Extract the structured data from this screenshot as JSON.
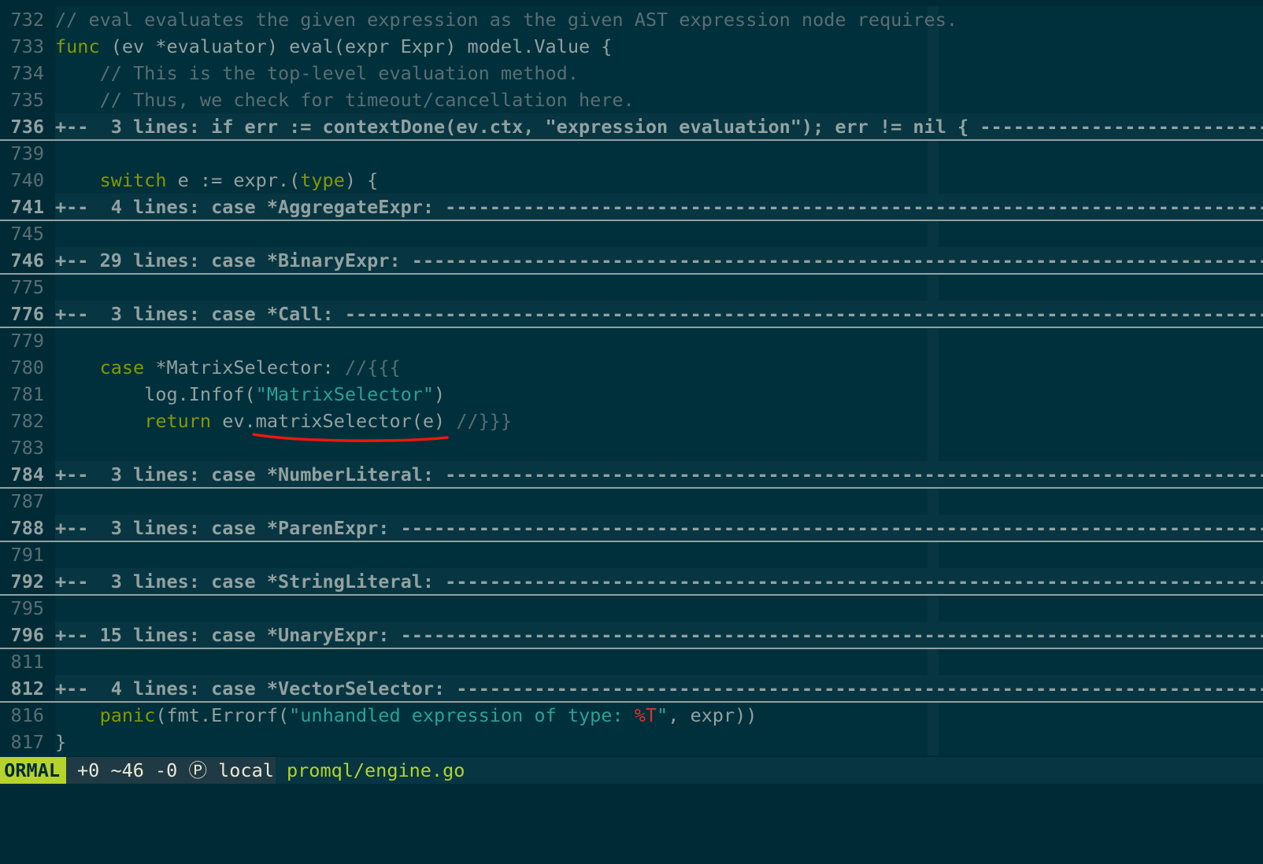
{
  "editor": {
    "lines": [
      {
        "num": "732",
        "fold": false,
        "tokens": [
          {
            "t": "// eval evaluates the given expression as the given AST expression node requires.",
            "c": "comment"
          }
        ]
      },
      {
        "num": "733",
        "fold": false,
        "tokens": [
          {
            "t": "func",
            "c": "kw"
          },
          {
            "t": " (ev *evaluator) eval(expr Expr) model.Value {",
            "c": "plain"
          }
        ]
      },
      {
        "num": "734",
        "fold": false,
        "tokens": [
          {
            "t": "    ",
            "c": "plain"
          },
          {
            "t": "// This is the top-level evaluation method.",
            "c": "comment"
          }
        ]
      },
      {
        "num": "735",
        "fold": false,
        "tokens": [
          {
            "t": "    ",
            "c": "plain"
          },
          {
            "t": "// Thus, we check for timeout/cancellation here.",
            "c": "comment"
          }
        ]
      },
      {
        "num": "736",
        "fold": true,
        "tokens": [
          {
            "t": "+--  3 lines: if err := contextDone(ev.ctx, \"expression evaluation\"); err != nil { ------------------------------------------------",
            "c": "fold"
          }
        ]
      },
      {
        "num": "739",
        "fold": false,
        "tokens": []
      },
      {
        "num": "740",
        "fold": false,
        "tokens": [
          {
            "t": "    ",
            "c": "plain"
          },
          {
            "t": "switch",
            "c": "kw"
          },
          {
            "t": " e := expr.(",
            "c": "plain"
          },
          {
            "t": "type",
            "c": "kw"
          },
          {
            "t": ") {",
            "c": "plain"
          }
        ]
      },
      {
        "num": "741",
        "fold": true,
        "tokens": [
          {
            "t": "+--  4 lines: case *AggregateExpr: ------------------------------------------------------------------------------------------------",
            "c": "fold"
          }
        ]
      },
      {
        "num": "745",
        "fold": false,
        "tokens": []
      },
      {
        "num": "746",
        "fold": true,
        "tokens": [
          {
            "t": "+-- 29 lines: case *BinaryExpr: ---------------------------------------------------------------------------------------------------",
            "c": "fold"
          }
        ]
      },
      {
        "num": "775",
        "fold": false,
        "tokens": []
      },
      {
        "num": "776",
        "fold": true,
        "tokens": [
          {
            "t": "+--  3 lines: case *Call: -------------------------------------------------------------------------------------------------------------",
            "c": "fold"
          }
        ]
      },
      {
        "num": "779",
        "fold": false,
        "tokens": []
      },
      {
        "num": "780",
        "fold": false,
        "tokens": [
          {
            "t": "    ",
            "c": "plain"
          },
          {
            "t": "case",
            "c": "kw"
          },
          {
            "t": " *MatrixSelector: ",
            "c": "plain"
          },
          {
            "t": "//{{{",
            "c": "comment"
          }
        ]
      },
      {
        "num": "781",
        "fold": false,
        "tokens": [
          {
            "t": "        log.Infof(",
            "c": "plain"
          },
          {
            "t": "\"MatrixSelector\"",
            "c": "str"
          },
          {
            "t": ")",
            "c": "plain"
          }
        ]
      },
      {
        "num": "782",
        "fold": false,
        "tokens": [
          {
            "t": "        ",
            "c": "plain"
          },
          {
            "t": "return",
            "c": "kw"
          },
          {
            "t": " ev.matrixSelector(e) ",
            "c": "plain"
          },
          {
            "t": "//}}}",
            "c": "comment"
          }
        ]
      },
      {
        "num": "783",
        "fold": false,
        "tokens": []
      },
      {
        "num": "784",
        "fold": true,
        "tokens": [
          {
            "t": "+--  3 lines: case *NumberLiteral: ------------------------------------------------------------------------------------------------",
            "c": "fold"
          }
        ]
      },
      {
        "num": "787",
        "fold": false,
        "tokens": []
      },
      {
        "num": "788",
        "fold": true,
        "tokens": [
          {
            "t": "+--  3 lines: case *ParenExpr: ----------------------------------------------------------------------------------------------------",
            "c": "fold"
          }
        ]
      },
      {
        "num": "791",
        "fold": false,
        "tokens": []
      },
      {
        "num": "792",
        "fold": true,
        "tokens": [
          {
            "t": "+--  3 lines: case *StringLiteral: ------------------------------------------------------------------------------------------------",
            "c": "fold"
          }
        ]
      },
      {
        "num": "795",
        "fold": false,
        "tokens": []
      },
      {
        "num": "796",
        "fold": true,
        "tokens": [
          {
            "t": "+-- 15 lines: case *UnaryExpr: ----------------------------------------------------------------------------------------------------",
            "c": "fold"
          }
        ]
      },
      {
        "num": "811",
        "fold": false,
        "tokens": []
      },
      {
        "num": "812",
        "fold": true,
        "tokens": [
          {
            "t": "+--  4 lines: case *VectorSelector: -----------------------------------------------------------------------------------------------",
            "c": "fold"
          }
        ]
      },
      {
        "num": "816",
        "fold": false,
        "tokens": [
          {
            "t": "    ",
            "c": "plain"
          },
          {
            "t": "panic",
            "c": "kw"
          },
          {
            "t": "(fmt.Errorf(",
            "c": "plain"
          },
          {
            "t": "\"unhandled expression of type: ",
            "c": "str"
          },
          {
            "t": "%T",
            "c": "fmt"
          },
          {
            "t": "\"",
            "c": "str"
          },
          {
            "t": ", expr))",
            "c": "plain"
          }
        ]
      },
      {
        "num": "817",
        "fold": false,
        "tokens": [
          {
            "t": "}",
            "c": "plain"
          }
        ]
      }
    ]
  },
  "statusline": {
    "mode": "ORMAL",
    "git": "+0 ~46 -0 Ⓟ local",
    "file": "promql/engine.go"
  },
  "colors": {
    "background": "#002b36",
    "keyword": "#859900",
    "string": "#2aa198",
    "comment": "#586e75",
    "mode_accent": "#b5d32c",
    "annotation": "#e8190c"
  },
  "annotation": {
    "type": "red-underline",
    "target": "matrixSelector(e)"
  }
}
